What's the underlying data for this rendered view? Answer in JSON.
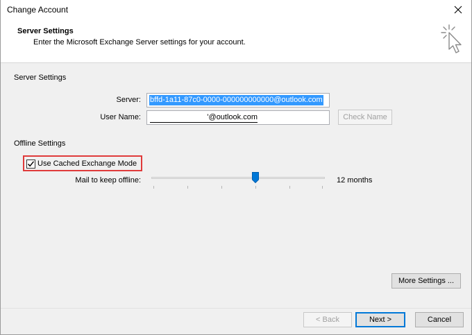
{
  "window": {
    "title": "Change Account",
    "close_glyph": "✕"
  },
  "header": {
    "title": "Server Settings",
    "subtitle": "Enter the Microsoft Exchange Server settings for your account.",
    "icon": "cursor-click-icon"
  },
  "server_settings": {
    "section_label": "Server Settings",
    "server_label": "Server:",
    "server_value": "bffd-1a11-87c0-0000-000000000000@outlook.com",
    "username_label": "User Name:",
    "username_value": "'@outlook.com",
    "check_name_label": "Check Name"
  },
  "offline_settings": {
    "section_label": "Offline Settings",
    "cached_mode_label": "Use Cached Exchange Mode",
    "cached_mode_checked": true,
    "mail_keep_label": "Mail to keep offline:",
    "mail_keep_value": "12 months",
    "slider_fraction": 0.6
  },
  "buttons": {
    "more_settings": "More Settings ...",
    "back": "< Back",
    "next": "Next >",
    "cancel": "Cancel"
  },
  "colors": {
    "accent": "#0078d7",
    "highlight": "#3399ff",
    "annotation": "#e03a3a"
  }
}
